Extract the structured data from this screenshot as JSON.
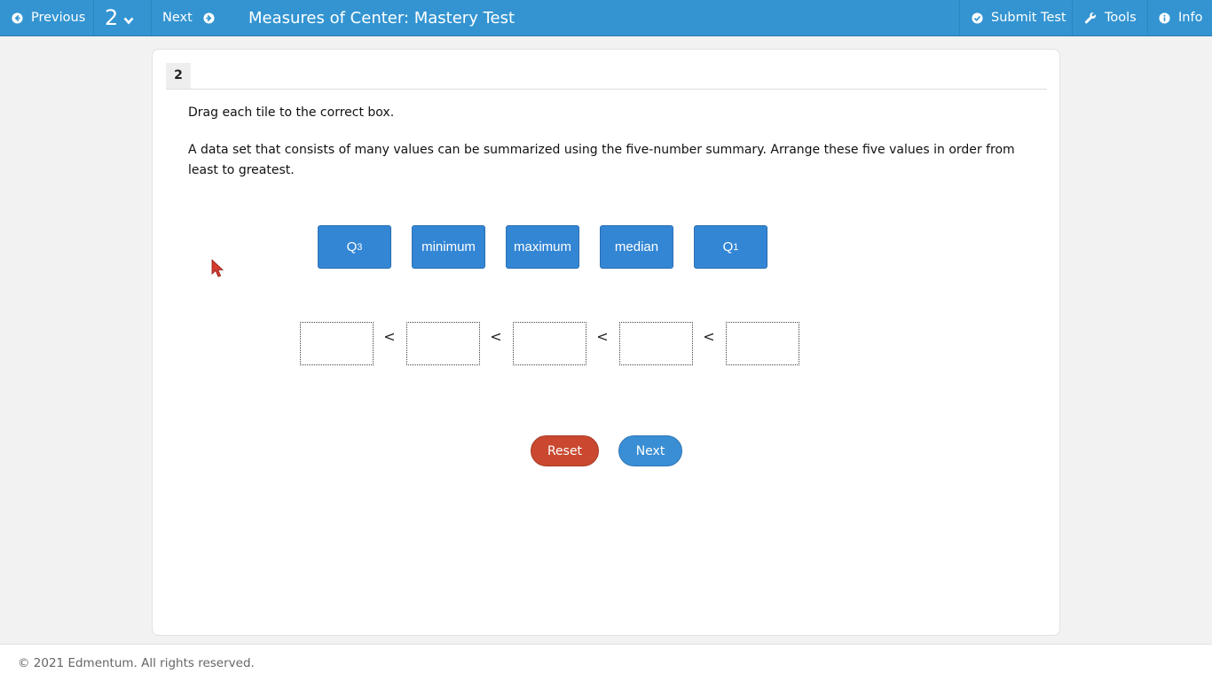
{
  "topbar": {
    "prev_label": "Previous",
    "question_number": "2",
    "next_label": "Next",
    "title": "Measures of Center: Mastery Test",
    "submit_label": "Submit Test",
    "tools_label": "Tools",
    "info_label": "Info",
    "bar_color": "#3394d1"
  },
  "question": {
    "number": "2",
    "instruction": "Drag each tile to the correct box.",
    "prompt": "A data set that consists of many values can be summarized using the five-number summary. Arrange these five values in order from least to greatest."
  },
  "tiles": [
    {
      "base": "Q",
      "sub": "3"
    },
    {
      "base": "minimum",
      "sub": ""
    },
    {
      "base": "maximum",
      "sub": ""
    },
    {
      "base": "median",
      "sub": ""
    },
    {
      "base": "Q",
      "sub": "1"
    }
  ],
  "drop_zone": {
    "separator": "<",
    "boxes": [
      "",
      "",
      "",
      "",
      ""
    ]
  },
  "actions": {
    "reset_label": "Reset",
    "next_label": "Next",
    "reset_color": "#c9482f",
    "next_color": "#3a8ed4"
  },
  "footer": {
    "copyright": "© 2021 Edmentum. All rights reserved."
  }
}
